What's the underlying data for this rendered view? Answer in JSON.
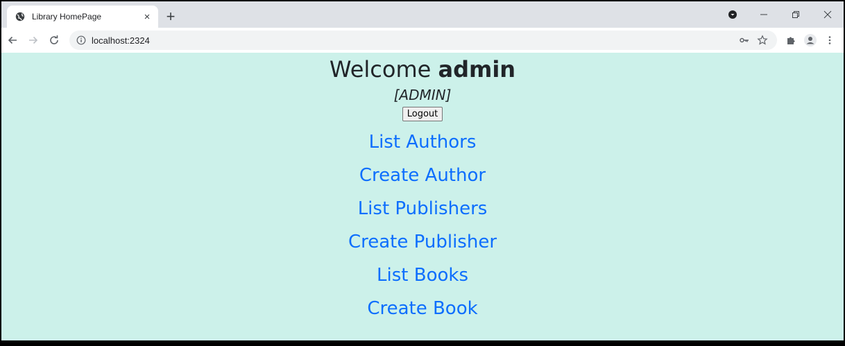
{
  "browser": {
    "tab_title": "Library HomePage",
    "url": "localhost:2324",
    "tab_close": "×",
    "new_tab": "+"
  },
  "page": {
    "welcome_prefix": "Welcome ",
    "username": "admin",
    "role": "[ADMIN]",
    "logout_label": "Logout",
    "links": [
      "List Authors",
      "Create Author",
      "List Publishers",
      "Create Publisher",
      "List Books",
      "Create Book"
    ]
  },
  "colors": {
    "page_background": "#ccf1ea",
    "link": "#0d6efd"
  }
}
